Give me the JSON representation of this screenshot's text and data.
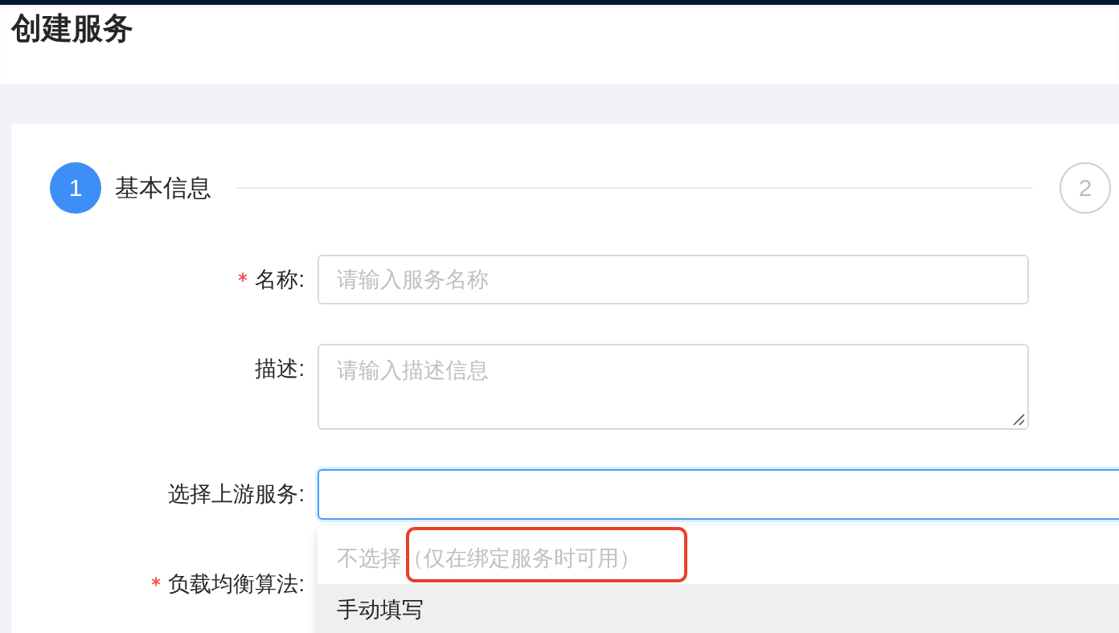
{
  "page": {
    "title": "创建服务"
  },
  "steps": [
    {
      "number": "1",
      "label": "基本信息",
      "selected": true
    },
    {
      "number": "2",
      "selected": false
    }
  ],
  "form": {
    "fields": [
      {
        "kind": "input",
        "label": "名称:",
        "required": true,
        "placeholder": "请输入服务名称"
      },
      {
        "kind": "textarea",
        "label": "描述:",
        "required": false,
        "placeholder": "请输入描述信息"
      },
      {
        "kind": "select",
        "label": "选择上游服务:",
        "required": false,
        "focused": true,
        "expanded": true,
        "options": [
          {
            "label": "不选择（仅在绑定服务时可用）",
            "disabled": true,
            "active": false,
            "selected": false,
            "annotated": true
          },
          {
            "label": "手动填写",
            "disabled": false,
            "active": true,
            "selected": false,
            "annotated": false
          }
        ]
      },
      {
        "kind": "covered",
        "label": "负载均衡算法:",
        "required": true
      }
    ]
  }
}
